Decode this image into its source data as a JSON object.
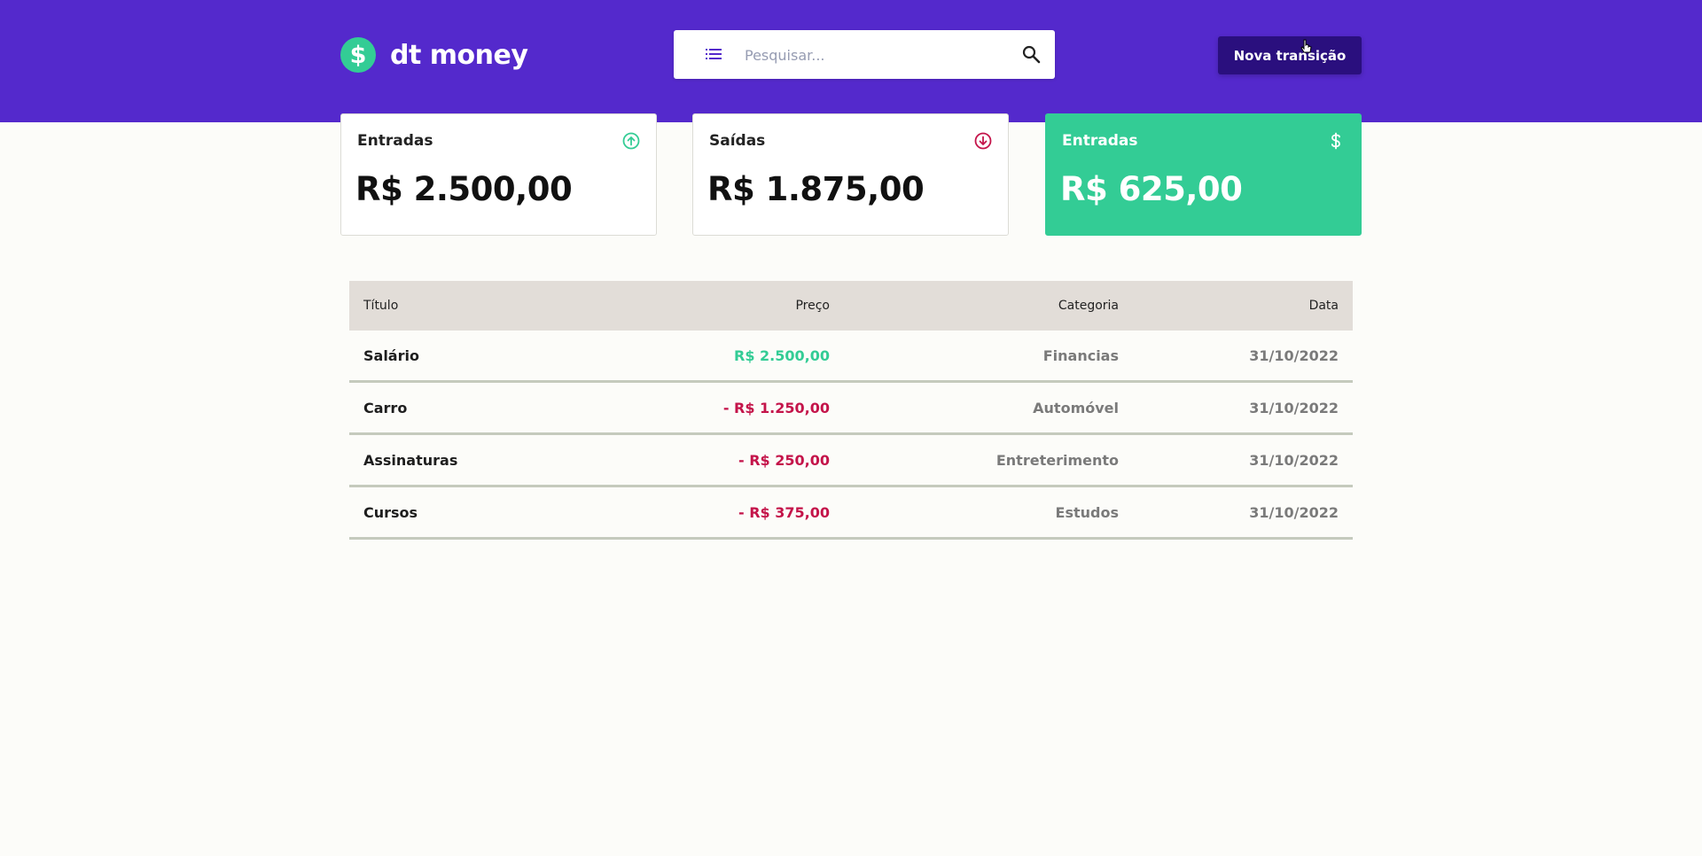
{
  "app": {
    "logo_symbol": "$",
    "name": "dt money"
  },
  "header": {
    "search_placeholder": "Pesquisar...",
    "new_transaction_label": "Nova transição",
    "menu_icon": "list-icon",
    "search_icon": "magnifier-icon"
  },
  "summary": [
    {
      "title": "Entradas",
      "value": "R$ 2.500,00",
      "icon": "arrow-up-circle-icon",
      "icon_color": "#33cc95"
    },
    {
      "title": "Saídas",
      "value": "R$ 1.875,00",
      "icon": "arrow-down-circle-icon",
      "icon_color": "#c4144a"
    },
    {
      "title": "Entradas",
      "value": "R$ 625,00",
      "icon": "dollar-icon",
      "icon_color": "#ffffff"
    }
  ],
  "table": {
    "headers": {
      "title": "Título",
      "price": "Preço",
      "category": "Categoria",
      "date": "Data"
    },
    "rows": [
      {
        "title": "Salário",
        "price": "R$ 2.500,00",
        "type": "income",
        "category": "Financias",
        "date": "31/10/2022"
      },
      {
        "title": "Carro",
        "price": "- R$ 1.250,00",
        "type": "outcome",
        "category": "Automóvel",
        "date": "31/10/2022"
      },
      {
        "title": "Assinaturas",
        "price": "- R$ 250,00",
        "type": "outcome",
        "category": "Entreterimento",
        "date": "31/10/2022"
      },
      {
        "title": "Cursos",
        "price": "- R$ 375,00",
        "type": "outcome",
        "category": "Estudos",
        "date": "31/10/2022"
      }
    ]
  },
  "colors": {
    "header_bg": "#5429cc",
    "button_bg": "#2a0f7e",
    "income": "#33cc95",
    "outcome": "#c4144a",
    "table_header_bg": "#e2ddd8"
  }
}
